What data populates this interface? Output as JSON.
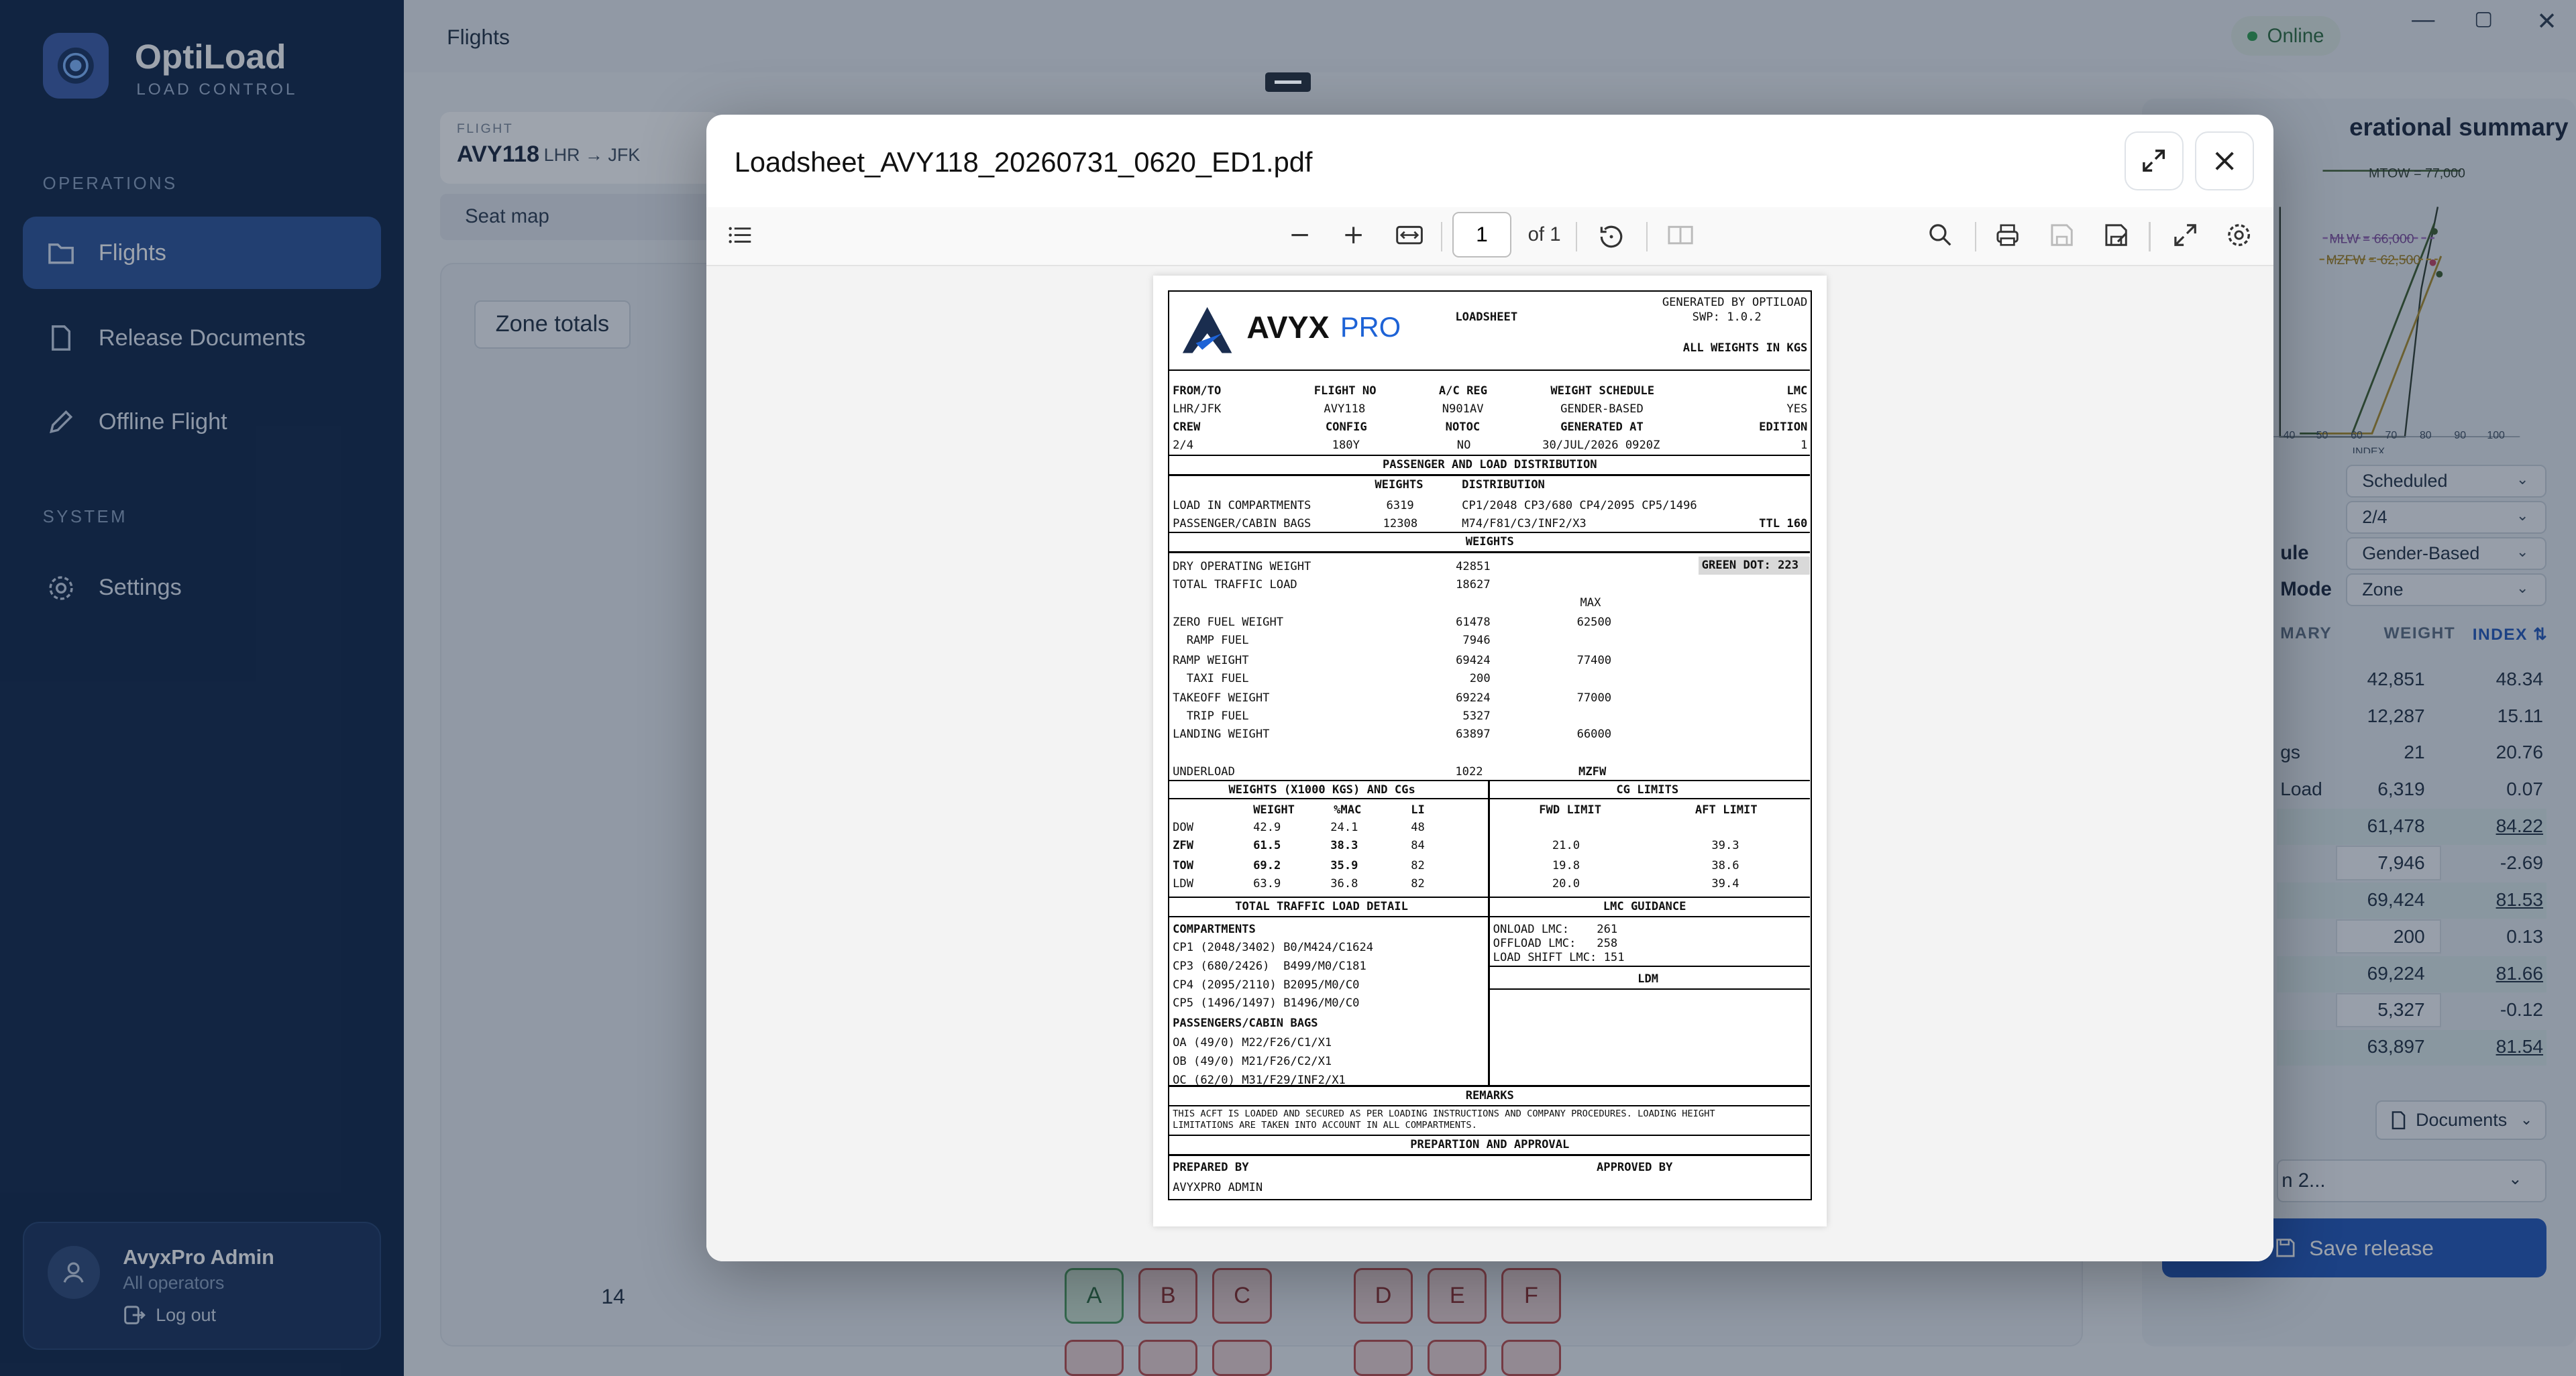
{
  "app": {
    "name": "OptiLoad",
    "subtitle": "LOAD CONTROL",
    "page_title": "Flights",
    "status": "Online"
  },
  "sidebar": {
    "sections": {
      "operations": "OPERATIONS",
      "system": "SYSTEM"
    },
    "items": [
      {
        "label": "Flights",
        "icon": "folder-icon",
        "active": true
      },
      {
        "label": "Release Documents",
        "icon": "document-icon"
      },
      {
        "label": "Offline Flight",
        "icon": "pencil-icon"
      },
      {
        "label": "Settings",
        "icon": "gear-icon"
      }
    ],
    "user": {
      "name": "AvyxPro Admin",
      "role": "All operators",
      "logout": "Log out"
    }
  },
  "flight": {
    "label": "FLIGHT",
    "code": "AVY118",
    "from": "LHR",
    "to": "JFK"
  },
  "tabs": {
    "seat_map": "Seat map"
  },
  "seatmap": {
    "zone_button": "Zone totals",
    "row": "14",
    "seats_left": [
      "A",
      "B",
      "C"
    ],
    "seats_right": [
      "D",
      "E",
      "F"
    ]
  },
  "summary": {
    "title": "erational summary",
    "envelope": {
      "mtow": "MTOW = 77,000",
      "mlw": "MLW = 66,000",
      "mzfw": "MZFW = 62,500",
      "axis_label": "INDEX",
      "ticks": [
        "40",
        "50",
        "60",
        "70",
        "80",
        "90",
        "100"
      ]
    },
    "selects": [
      {
        "label": "",
        "value": "Scheduled"
      },
      {
        "label": "",
        "value": "2/4"
      },
      {
        "label": "ule",
        "value": "Gender-Based"
      },
      {
        "label": "Mode",
        "value": "Zone"
      }
    ],
    "headers": {
      "summary": "MARY",
      "weight": "WEIGHT",
      "index": "INDEX ⇅"
    },
    "rows": [
      {
        "label": "",
        "weight": "42,851",
        "index": "48.34",
        "hl": false
      },
      {
        "label": "",
        "weight": "12,287",
        "index": "15.11",
        "hl": false
      },
      {
        "label": "gs",
        "weight": "21",
        "index": "20.76",
        "hl": false
      },
      {
        "label": "Load",
        "weight": "6,319",
        "index": "0.07",
        "hl": false
      },
      {
        "label": "",
        "weight": "61,478",
        "index": "84.22",
        "hl": true
      },
      {
        "label": "",
        "weight": "7,946",
        "index": "-2.69",
        "hl": false,
        "box": true
      },
      {
        "label": "",
        "weight": "69,424",
        "index": "81.53",
        "hl": true
      },
      {
        "label": "",
        "weight": "200",
        "index": "0.13",
        "hl": false,
        "box": true
      },
      {
        "label": "",
        "weight": "69,224",
        "index": "81.66",
        "hl": true
      },
      {
        "label": "",
        "weight": "5,327",
        "index": "-0.12",
        "hl": false,
        "box": true
      },
      {
        "label": "",
        "weight": "63,897",
        "index": "81.54",
        "hl": true
      }
    ],
    "documents": "Documents",
    "release": "n 2...",
    "save": "Save release"
  },
  "modal": {
    "filename": "Loadsheet_AVY118_20260731_0620_ED1.pdf",
    "page_current": "1",
    "page_of": "of 1"
  },
  "loadsheet": {
    "brand": "AVYX",
    "brand2": "PRO",
    "doc_title": "LOADSHEET",
    "gen1": "GENERATED BY OPTILOAD",
    "gen2": "SWP: 1.0.2",
    "allkg": "ALL WEIGHTS IN KGS",
    "hdr1": [
      "FROM/TO",
      "FLIGHT NO",
      "A/C REG",
      "WEIGHT SCHEDULE",
      "LMC"
    ],
    "val1": [
      "LHR/JFK",
      "AVY118",
      "N901AV",
      "GENDER-BASED",
      "YES"
    ],
    "hdr2": [
      "CREW",
      "CONFIG",
      "NOTOC",
      "GENERATED AT",
      "EDITION"
    ],
    "val2": [
      "2/4",
      "180Y",
      "NO",
      "30/JUL/2026 0920Z",
      "1"
    ],
    "pld_title": "PASSENGER AND LOAD DISTRIBUTION",
    "pld_h": [
      "WEIGHTS",
      "DISTRIBUTION"
    ],
    "lic": [
      "LOAD IN COMPARTMENTS",
      "6319",
      "CP1/2048  CP3/680  CP4/2095  CP5/1496"
    ],
    "pcb": [
      "PASSENGER/CABIN BAGS",
      "12308",
      "M74/F81/C3/INF2/X3",
      "TTL 160"
    ],
    "weights_title": "WEIGHTS",
    "green_dot": "GREEN DOT: 223",
    "max": "MAX",
    "w_rows": [
      {
        "l": "DRY OPERATING WEIGHT",
        "v": "42851",
        "m": ""
      },
      {
        "l": "TOTAL TRAFFIC LOAD",
        "v": "18627",
        "m": ""
      },
      {
        "l": "ZERO FUEL WEIGHT",
        "v": "61478",
        "m": "62500"
      },
      {
        "l": "  RAMP FUEL",
        "v": "7946",
        "m": ""
      },
      {
        "l": "RAMP WEIGHT",
        "v": "69424",
        "m": "77400"
      },
      {
        "l": "  TAXI FUEL",
        "v": "200",
        "m": ""
      },
      {
        "l": "TAKEOFF WEIGHT",
        "v": "69224",
        "m": "77000"
      },
      {
        "l": "  TRIP FUEL",
        "v": "5327",
        "m": ""
      },
      {
        "l": "LANDING WEIGHT",
        "v": "63897",
        "m": "66000"
      }
    ],
    "underload": [
      "UNDERLOAD",
      "1022",
      "MZFW"
    ],
    "cg_title": "WEIGHTS (X1000 KGS) AND CGs",
    "cg_h": [
      "WEIGHT",
      "%MAC",
      "LI"
    ],
    "cg_rows": [
      {
        "l": "DOW",
        "w": "42.9",
        "m": "24.1",
        "i": "48",
        "b": false
      },
      {
        "l": "ZFW",
        "w": "61.5",
        "m": "38.3",
        "i": "84",
        "b": true
      },
      {
        "l": "TOW",
        "w": "69.2",
        "m": "35.9",
        "i": "82",
        "b": true
      },
      {
        "l": "LDW",
        "w": "63.9",
        "m": "36.8",
        "i": "82",
        "b": false
      }
    ],
    "lim_title": "CG LIMITS",
    "lim_h": [
      "FWD LIMIT",
      "AFT LIMIT"
    ],
    "lim_rows": [
      [
        "21.0",
        "39.3"
      ],
      [
        "19.8",
        "38.6"
      ],
      [
        "20.0",
        "39.4"
      ]
    ],
    "ttl_title": "TOTAL TRAFFIC LOAD DETAIL",
    "compartments": "COMPARTMENTS",
    "cp": [
      "CP1 (2048/3402) B0/M424/C1624",
      "CP3 (680/2426)  B499/M0/C181",
      "CP4 (2095/2110) B2095/M0/C0",
      "CP5 (1496/1497) B1496/M0/C0"
    ],
    "pcb_title": "PASSENGERS/CABIN BAGS",
    "pax": [
      "OA (49/0) M22/F26/C1/X1",
      "OB (49/0) M21/F26/C2/X1",
      "OC (62/0) M31/F29/INF2/X1"
    ],
    "lmc_title": "LMC GUIDANCE",
    "lmc": [
      "ONLOAD LMC:    261",
      "OFFLOAD LMC:   258",
      "LOAD SHIFT LMC: 151"
    ],
    "ldm": "LDM",
    "remarks_title": "REMARKS",
    "remarks1": "THIS ACFT IS LOADED AND SECURED AS PER LOADING INSTRUCTIONS AND COMPANY PROCEDURES. LOADING HEIGHT",
    "remarks2": "LIMITATIONS ARE TAKEN INTO ACCOUNT IN ALL COMPARTMENTS.",
    "prep_title": "PREPARTION AND APPROVAL",
    "prepared": "PREPARED BY",
    "approved": "APPROVED BY",
    "preparer": "AVYXPRO ADMIN"
  }
}
